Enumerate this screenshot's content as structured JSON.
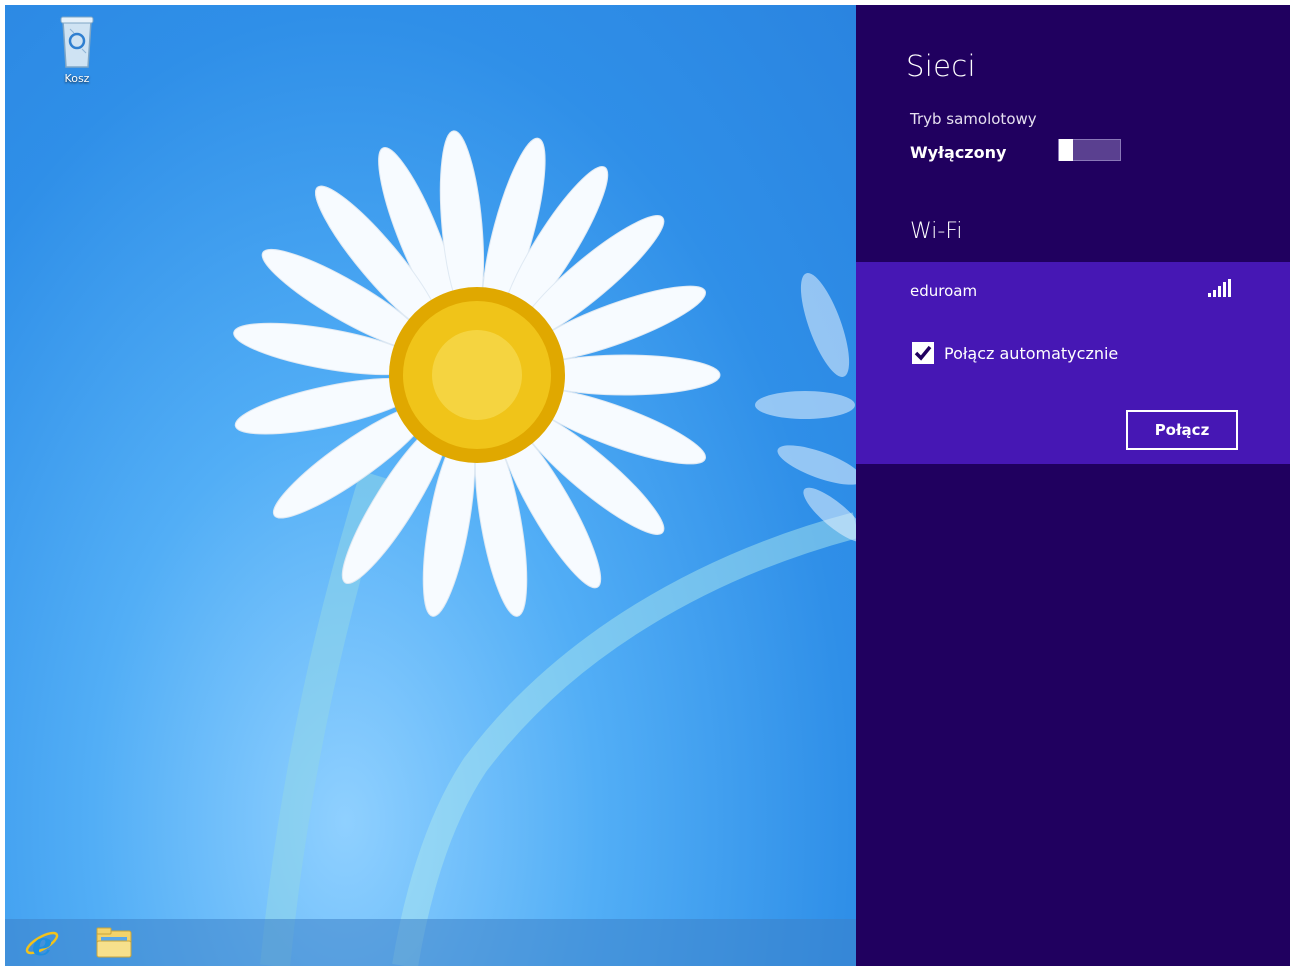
{
  "desktop": {
    "icons": [
      {
        "label": "Kosz",
        "icon": "recycle-bin-icon"
      }
    ]
  },
  "taskbar": {
    "pinned": [
      {
        "name": "internet-explorer",
        "icon": "internet-explorer-icon"
      },
      {
        "name": "file-explorer",
        "icon": "folder-icon"
      }
    ]
  },
  "charm": {
    "title": "Sieci",
    "airplane": {
      "label": "Tryb samolotowy",
      "state": "Wyłączony",
      "on": false
    },
    "wifi_heading": "Wi-Fi",
    "networks": [
      {
        "name": "eduroam",
        "signal_icon": "signal-strength-icon",
        "auto_connect_label": "Połącz automatycznie",
        "auto_connect": true,
        "connect_label": "Połącz"
      }
    ]
  },
  "colors": {
    "charm_bg": "#20005f",
    "selected_network_bg": "#4617b4",
    "desktop_sky": "#3a9af0"
  }
}
